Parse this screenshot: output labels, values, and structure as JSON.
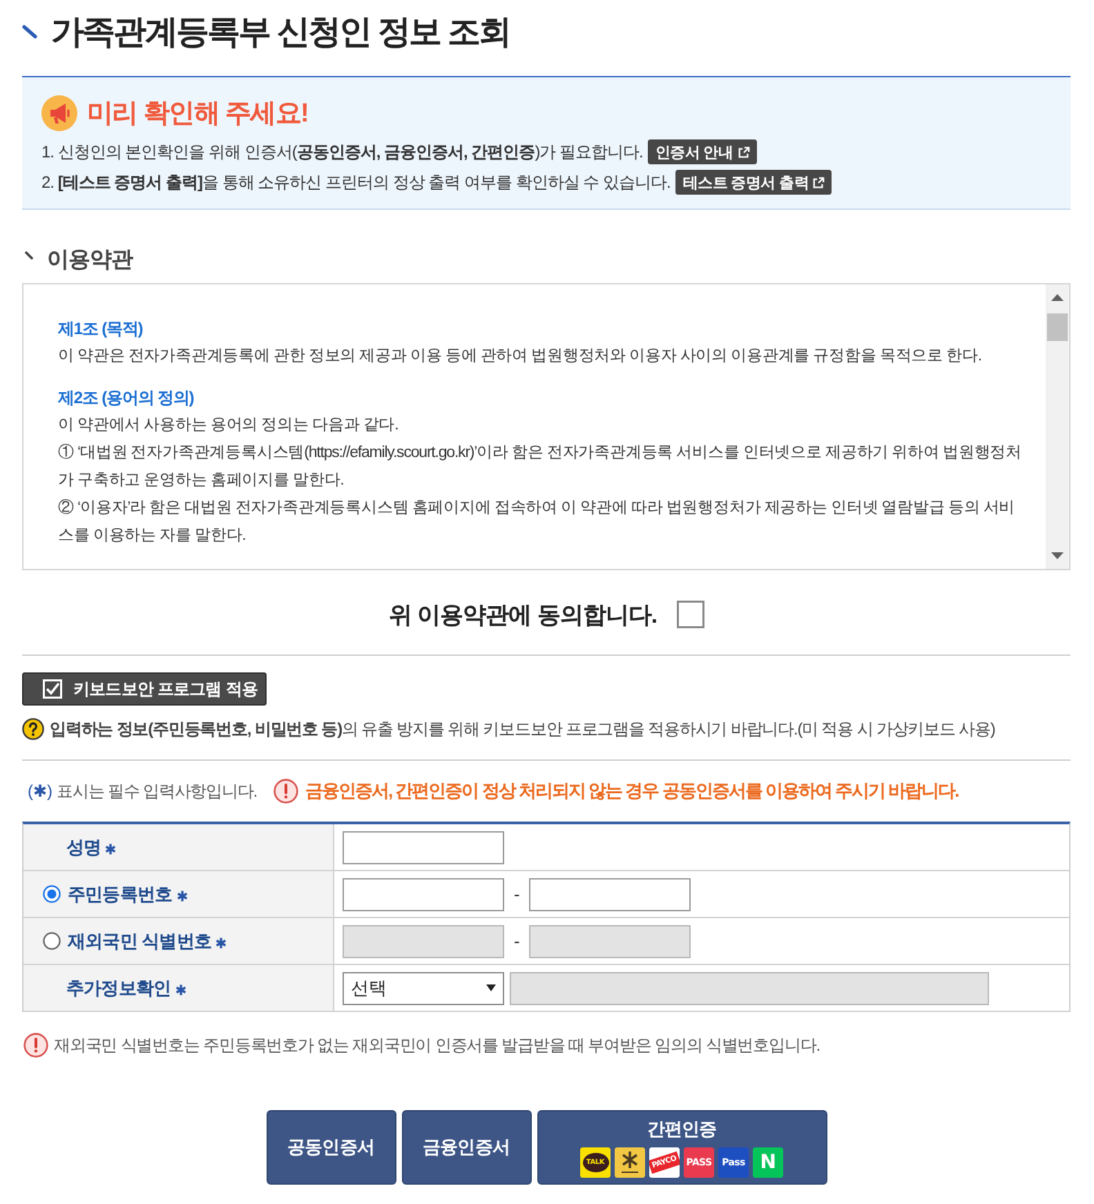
{
  "page": {
    "title": "가족관계등록부 신청인 정보 조회"
  },
  "notice": {
    "heading": "미리 확인해 주세요!",
    "items": [
      {
        "text": "1. 신청인의 본인확인을 위해 인증서(**공동인증서, 금융인증서, 간편인증**)가 필요합니다.",
        "button": "인증서 안내"
      },
      {
        "text": "2. **[테스트 증명서 출력]**을 통해 소유하신 프린터의 정상 출력 여부를 확인하실 수 있습니다.",
        "button": "테스트 증명서 출력"
      }
    ]
  },
  "terms": {
    "title": "이용약관",
    "paragraphs": [
      {
        "kind": "heading",
        "text": "제1조 (목적)"
      },
      {
        "kind": "body",
        "text": "이 약관은 전자가족관계등록에 관한 정보의 제공과 이용 등에 관하여 법원행정처와 이용자 사이의 이용관계를 규정함을 목적으로 한다."
      },
      {
        "kind": "heading",
        "text": "제2조 (용어의 정의)"
      },
      {
        "kind": "body",
        "text": "이 약관에서 사용하는 용어의 정의는 다음과 같다."
      },
      {
        "kind": "body",
        "text": "① ‘대법원 전자가족관계등록시스템(https://efamily.scourt.go.kr)’이라 함은 전자가족관계등록 서비스를 인터넷으로 제공하기 위하여 법원행정처가 구축하고 운영하는 홈페이지를 말한다."
      },
      {
        "kind": "body",
        "text": "② ‘이용자’라 함은 대법원 전자가족관계등록시스템 홈페이지에 접속하여 이 약관에 따라 법원행정처가 제공하는 인터넷 열람발급 등의 서비스를 이용하는 자를 말한다."
      }
    ],
    "agree": {
      "label": "위 이용약관에 동의합니다.",
      "checked": false
    }
  },
  "keyboard_security": {
    "label": "키보드보안 프로그램 적용",
    "checked": true,
    "help": "**입력하는 정보(주민등록번호, 비밀번호 등)**의 유출 방지를 위해 키보드보안 프로그램을 적용하시기 바랍니다.(미 적용 시 가상키보드 사용)"
  },
  "required_note": {
    "marker": "(✱)",
    "text": "표시는 필수 입력사항입니다."
  },
  "warning": "금융인증서, 간편인증이 정상 처리되지 않는 경우 공동인증서를 이용하여 주시기 바랍니다.",
  "form": {
    "rows": [
      {
        "kind": "text",
        "label": "성명",
        "required": true,
        "disabled": false
      },
      {
        "kind": "split",
        "label": "주민등록번호",
        "required": true,
        "radio": {
          "selected": true
        },
        "separator": "-",
        "disabled": false
      },
      {
        "kind": "split",
        "label": "재외국민 식별번호",
        "required": true,
        "radio": {
          "selected": false
        },
        "separator": "-",
        "disabled": true
      },
      {
        "kind": "select",
        "label": "추가정보확인",
        "required": true,
        "value": "선택",
        "extra_field": {
          "disabled": true
        }
      }
    ]
  },
  "footnote": "재외국민 식별번호는 주민등록번호가 없는 재외국민이 인증서를 발급받을 때 부여받은 임의의 식별번호입니다.",
  "auth_buttons": [
    {
      "kind": "plain",
      "label": "공동인증서"
    },
    {
      "kind": "plain",
      "label": "금융인증서"
    },
    {
      "kind": "easy",
      "label": "간편인증",
      "providers": [
        {
          "kind": "bubble",
          "label": "TALK",
          "color": "#f9e000"
        },
        {
          "kind": "star",
          "color": "#f2c744"
        },
        {
          "kind": "banner",
          "label": "PAYCO",
          "color": "#ffffff"
        },
        {
          "kind": "tile",
          "label": "PASS",
          "color": "#ea3a4f"
        },
        {
          "kind": "tile",
          "label": "Pass",
          "color": "#1d4fc0"
        },
        {
          "kind": "tile",
          "label": "N",
          "color": "#05c45a"
        }
      ]
    }
  ]
}
